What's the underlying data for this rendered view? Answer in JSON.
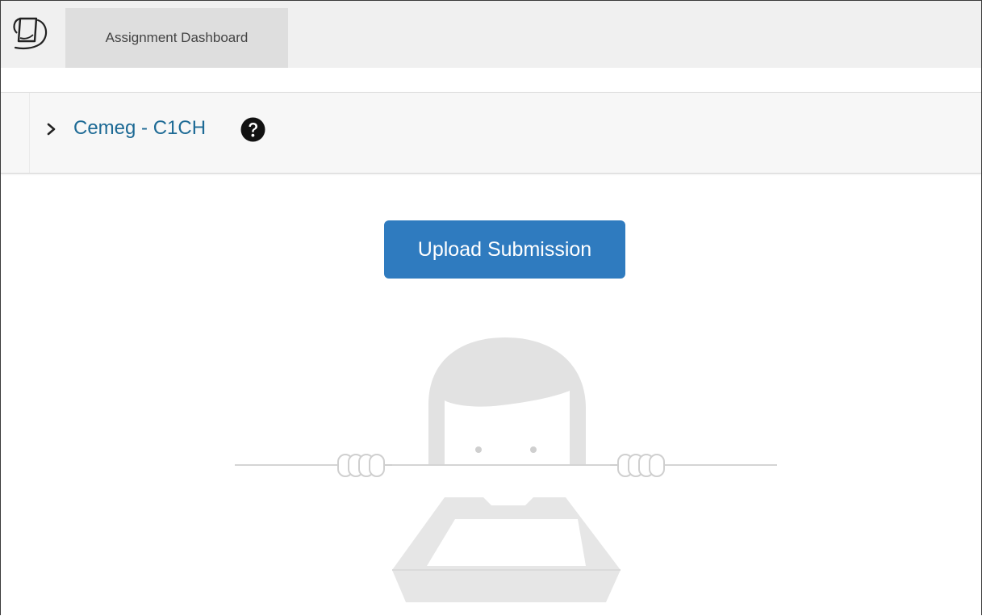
{
  "header": {
    "logo_icon": "feather-logo-icon",
    "tab_label": "Assignment Dashboard"
  },
  "breadcrumb": {
    "expand_icon": "chevron-right-icon",
    "course_label": "Cemeg - C1CH",
    "help_icon": "question-circle-icon"
  },
  "main": {
    "upload_button_label": "Upload Submission",
    "empty_illustration": "person-peeking-over-empty-tray-illustration"
  },
  "colors": {
    "topbar_bg": "#f0f0f0",
    "active_tab_bg": "#dedede",
    "link": "#1d6a95",
    "primary_button": "#2f7bbf",
    "illustration_gray": "#d9d9d9"
  }
}
